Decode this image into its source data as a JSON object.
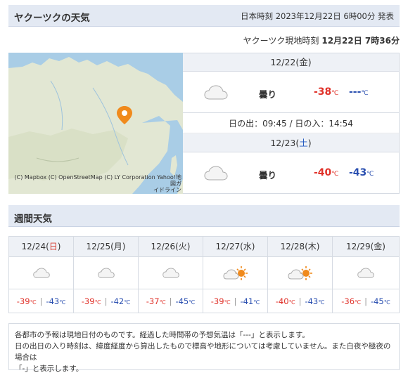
{
  "header": {
    "title": "ヤクーツクの天気",
    "announced": "日本時刻 2023年12月22日 6時00分 発表"
  },
  "local_time": {
    "label": "ヤクーツク現地時刻",
    "value": "12月22日 7時36分"
  },
  "map": {
    "credit_line1": "(C) Mapbox (C) OpenStreetMap (C) LY Corporation Yahoo!地図ガ",
    "credit_line2": "イドライン",
    "pin_icon": "location-pin-icon"
  },
  "forecast": [
    {
      "date": "12/22",
      "dow": "金",
      "weather": "曇り",
      "icon": "cloud-icon",
      "high": "-38",
      "low": "---",
      "unit": "℃"
    },
    {
      "date": "12/23",
      "dow": "土",
      "weather": "曇り",
      "icon": "cloud-icon",
      "high": "-40",
      "low": "-43",
      "unit": "℃"
    }
  ],
  "sun": "日の出：09:45 / 日の入：14:54",
  "weekly": {
    "title": "週間天気",
    "unit": "℃",
    "days": [
      {
        "date": "12/24",
        "dow": "日",
        "icon": "cloud-icon",
        "high": "-39",
        "low": "-43"
      },
      {
        "date": "12/25",
        "dow": "月",
        "icon": "cloud-icon",
        "high": "-39",
        "low": "-42"
      },
      {
        "date": "12/26",
        "dow": "火",
        "icon": "cloud-icon",
        "high": "-37",
        "low": "-45"
      },
      {
        "date": "12/27",
        "dow": "水",
        "icon": "sun-cloud-icon",
        "high": "-39",
        "low": "-41"
      },
      {
        "date": "12/28",
        "dow": "木",
        "icon": "sun-cloud-icon",
        "high": "-40",
        "low": "-43"
      },
      {
        "date": "12/29",
        "dow": "金",
        "icon": "cloud-icon",
        "high": "-36",
        "low": "-45"
      }
    ]
  },
  "notes": [
    "各都市の予報は現地日付のものです。経過した時間帯の予想気温は「---」と表示します。",
    "日の出日の入り時刻は、緯度経度から算出したもので標高や地形については考慮していません。また白夜や極夜の場合は",
    "「-」と表示します。"
  ],
  "colors": {
    "header_bg": "#e3e9f3",
    "high_temp": "#e0322a",
    "low_temp": "#2a4fb0",
    "saturday": "#2058c0",
    "sunday": "#d83a2e",
    "pin": "#f08a1c",
    "sun": "#f08a1c"
  }
}
